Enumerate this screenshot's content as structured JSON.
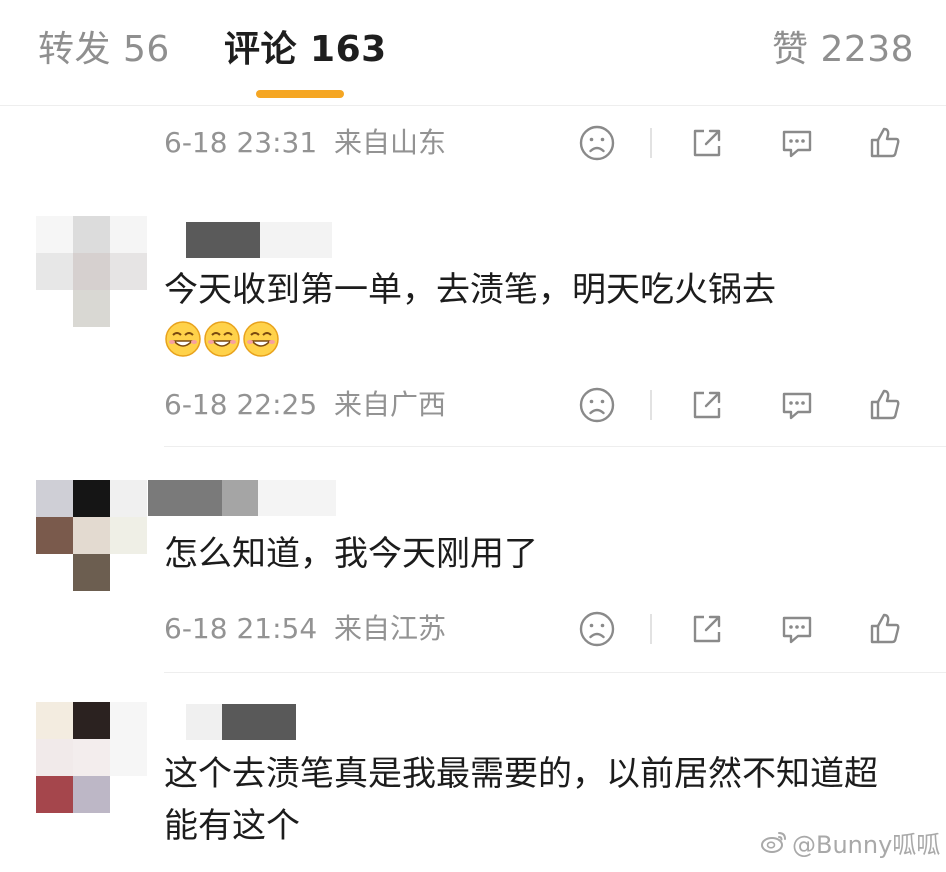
{
  "tabs": {
    "repost": "转发 56",
    "comments": "评论 163",
    "likes": "赞 2238"
  },
  "accent_color": "#f5a623",
  "comments": [
    {
      "text": "",
      "time": "6-18 23:31",
      "location": "来自山东"
    },
    {
      "text": "今天收到第一单，去渍笔，明天吃火锅去",
      "emojis": [
        "smile-emoji",
        "smile-emoji",
        "smile-emoji"
      ],
      "time": "6-18 22:25",
      "location": "来自广西"
    },
    {
      "text": "怎么知道，我今天刚用了",
      "time": "6-18 21:54",
      "location": "来自江苏"
    },
    {
      "text": "这个去渍笔真是我最需要的，以前居然不知道超能有这个"
    }
  ],
  "icons": {
    "dislike": "sad-face-icon",
    "share": "share-icon",
    "reply": "comment-bubble-icon",
    "like": "thumbs-up-icon"
  },
  "watermark": "@Bunny呱呱"
}
